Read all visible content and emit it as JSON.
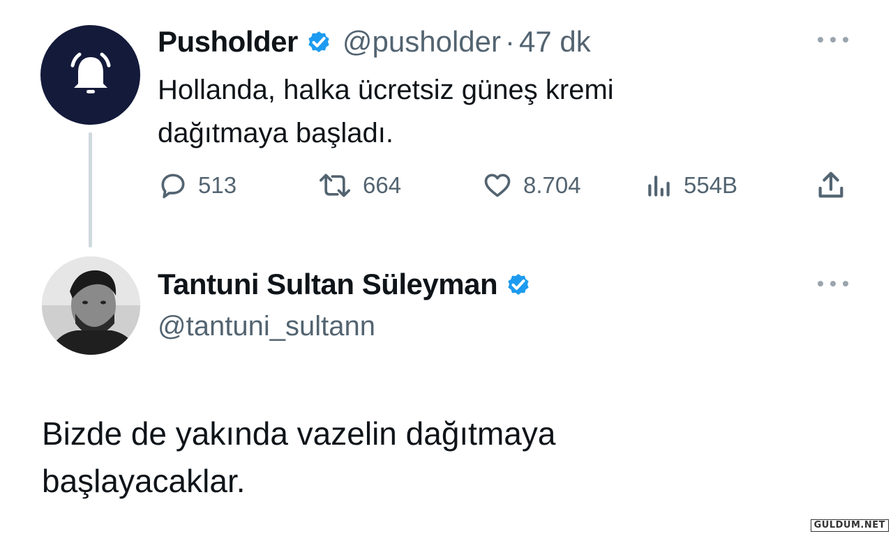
{
  "tweet1": {
    "name": "Pusholder",
    "handle": "@pusholder",
    "dot": "·",
    "time": "47 dk",
    "text_line1": "Hollanda, halka ücretsiz güneş kremi",
    "text_line2": "dağıtmaya başladı.",
    "avatar_icon": "bell-icon",
    "actions": {
      "replies": "513",
      "retweets": "664",
      "likes": "8.704",
      "views": "554B"
    }
  },
  "tweet2": {
    "name": "Tantuni Sultan Süleyman",
    "handle": "@tantuni_sultann",
    "text_line1": "Bizde de yakında vazelin dağıtmaya",
    "text_line2": "başlayacaklar."
  },
  "watermark": "GULDUM.NET",
  "colors": {
    "verified": "#1d9bf0",
    "muted": "#536471",
    "avatar_bg": "#141a3a",
    "thread_line": "#cfd9de"
  }
}
